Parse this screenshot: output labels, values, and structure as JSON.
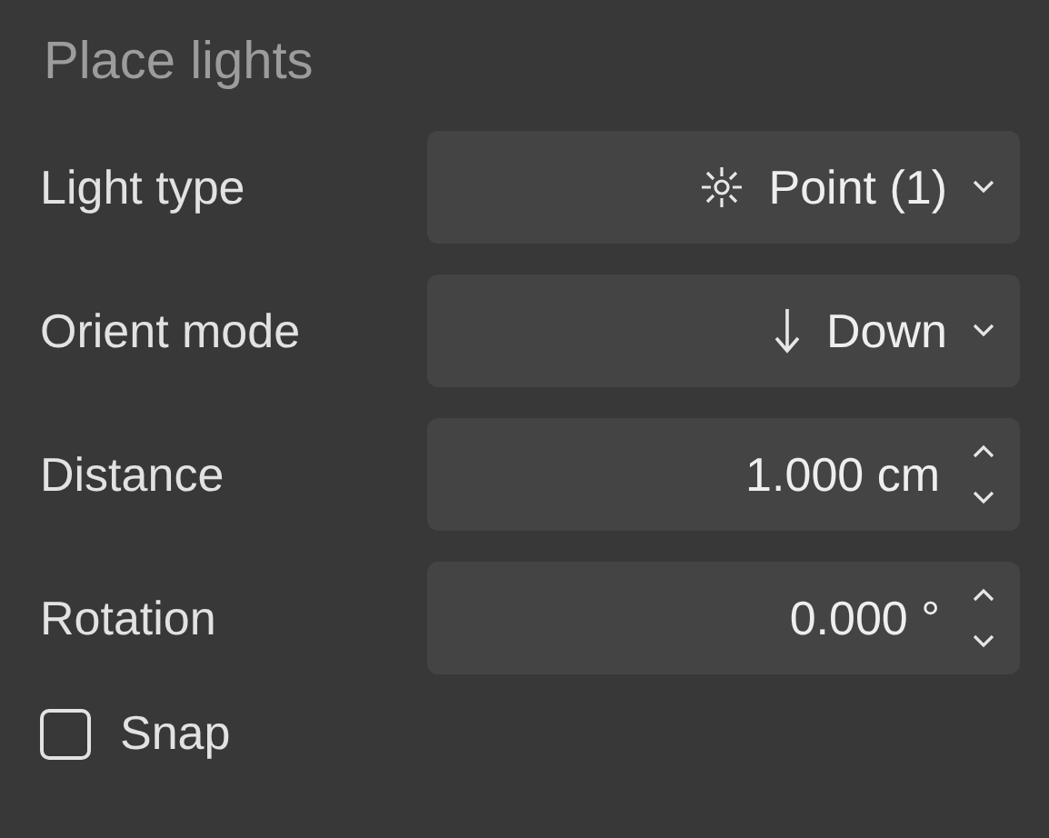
{
  "title": "Place lights",
  "fields": [
    {
      "kind": "dropdown",
      "label": "Light type",
      "value": "Point (1)"
    },
    {
      "kind": "dropdown",
      "label": "Orient mode",
      "value": "Down"
    },
    {
      "kind": "spinner",
      "label": "Distance",
      "value": "1.000 cm"
    },
    {
      "kind": "spinner",
      "label": "Rotation",
      "value": "0.000 °"
    }
  ],
  "snap": {
    "label": "Snap",
    "checked": false
  }
}
